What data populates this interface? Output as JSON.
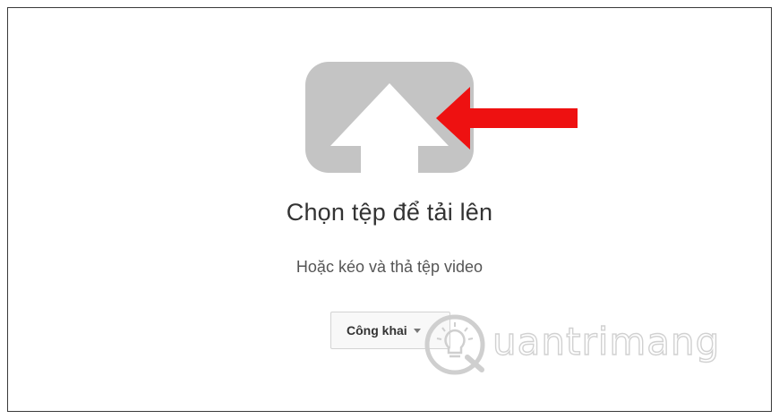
{
  "upload": {
    "title": "Chọn tệp để tải lên",
    "subtitle": "Hoặc kéo và thả tệp video",
    "privacy_label": "Công khai"
  },
  "icons": {
    "upload": "upload-arrow-icon",
    "pointer": "red-arrow-icon",
    "dropdown": "caret-down-icon",
    "watermark_logo": "lightbulb-icon"
  },
  "colors": {
    "icon_gray": "#c4c4c4",
    "pointer_red": "#ee1111",
    "text_dark": "#333333"
  },
  "watermark": {
    "text": "uantrimang"
  }
}
